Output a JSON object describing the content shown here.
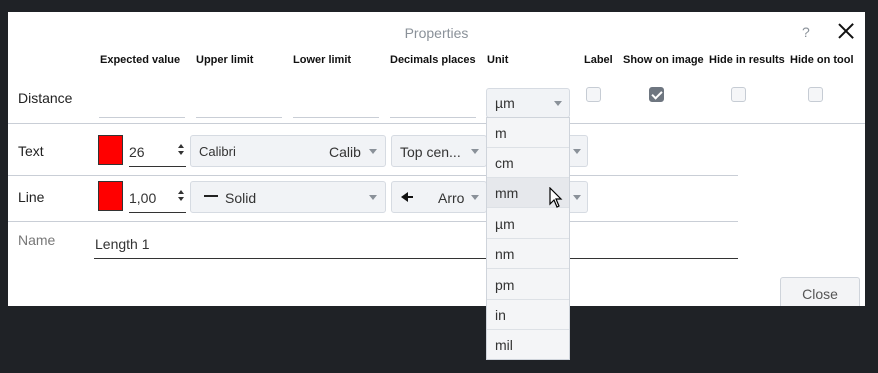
{
  "dialog": {
    "title": "Properties",
    "help": "?",
    "close_button": "Close"
  },
  "columns": [
    "Expected value",
    "Upper limit",
    "Lower limit",
    "Decimals places",
    "Unit",
    "Label",
    "Show on image",
    "Hide in results",
    "Hide on tool"
  ],
  "distance": {
    "label": "Distance",
    "unit_selected": "µm",
    "label_checked": false,
    "show_on_image_checked": true,
    "hide_in_results_checked": false,
    "hide_on_tool_checked": false
  },
  "text_row": {
    "label": "Text",
    "color": "#ff0000",
    "size": "26",
    "font": "Calibri",
    "font_preview": "Calib",
    "position": "Top cen..."
  },
  "line_row": {
    "label": "Line",
    "color": "#ff0000",
    "width": "1,00",
    "style": "Solid",
    "end": "Arro"
  },
  "name_row": {
    "label": "Name",
    "value": "Length 1"
  },
  "unit_dropdown": {
    "options": [
      "m",
      "cm",
      "mm",
      "µm",
      "nm",
      "pm",
      "in",
      "mil"
    ],
    "hovered": "mm"
  },
  "icons": {
    "close": "close-icon",
    "caret": "chevron-down-icon",
    "cursor": "mouse-pointer-icon",
    "solid_line": "solid-line-icon",
    "arrow": "arrow-left-icon"
  }
}
